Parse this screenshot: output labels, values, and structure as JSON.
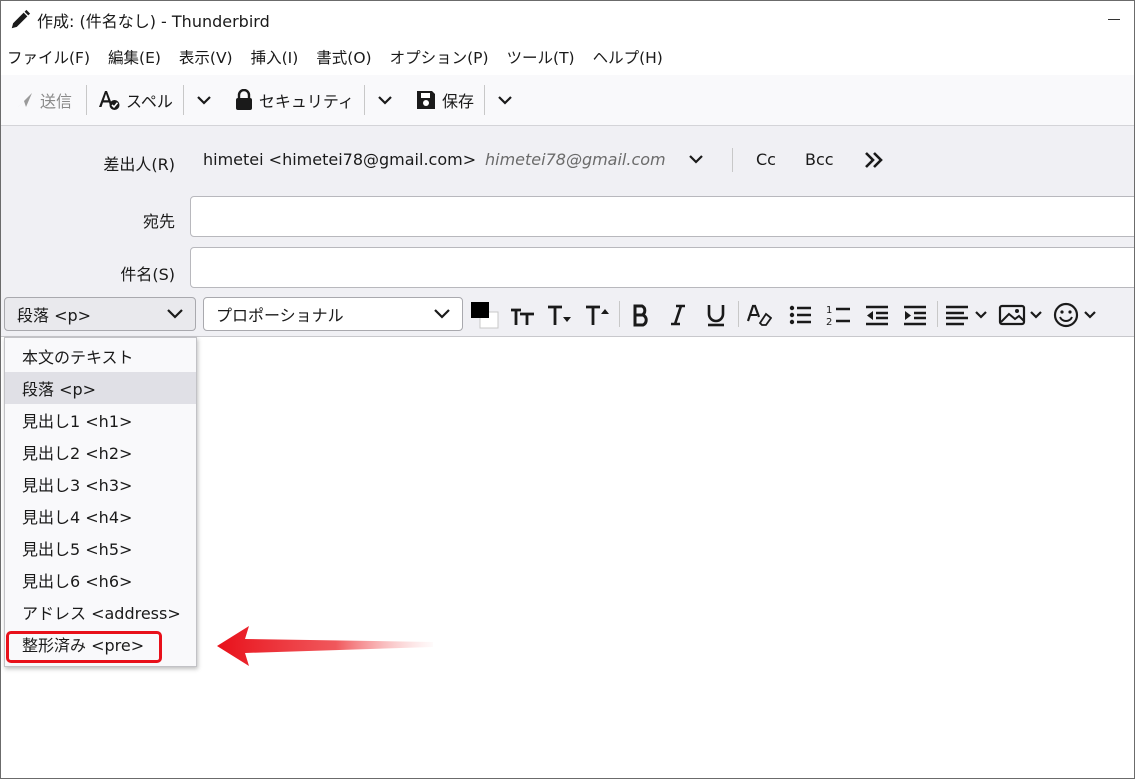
{
  "window": {
    "title": "作成: (件名なし) - Thunderbird"
  },
  "menubar": {
    "items": [
      "ファイル(F)",
      "編集(E)",
      "表示(V)",
      "挿入(I)",
      "書式(O)",
      "オプション(P)",
      "ツール(T)",
      "ヘルプ(H)"
    ]
  },
  "toolbar": {
    "send_label": "送信",
    "spell_label": "スペル",
    "security_label": "セキュリティ",
    "save_label": "保存"
  },
  "header": {
    "from_label": "差出人(R)",
    "from_name": "himetei <himetei78@gmail.com>",
    "from_email": "himetei78@gmail.com",
    "cc_label": "Cc",
    "bcc_label": "Bcc",
    "to_label": "宛先",
    "subject_label": "件名(S)",
    "to_value": "",
    "subject_value": ""
  },
  "formatbar": {
    "paragraph_format": "段落 <p>",
    "font": "プロポーショナル"
  },
  "dropdown": {
    "options": [
      "本文のテキスト",
      "段落 <p>",
      "見出し1 <h1>",
      "見出し2 <h2>",
      "見出し3 <h3>",
      "見出し4 <h4>",
      "見出し5 <h5>",
      "見出し6 <h6>",
      "アドレス <address>",
      "整形済み <pre>"
    ],
    "selected": "段落 <p>",
    "highlighted": "整形済み <pre>"
  },
  "colors": {
    "highlight_box": "#e8101a",
    "arrow": "#e8101a",
    "header_bg": "#f0f0f4"
  }
}
